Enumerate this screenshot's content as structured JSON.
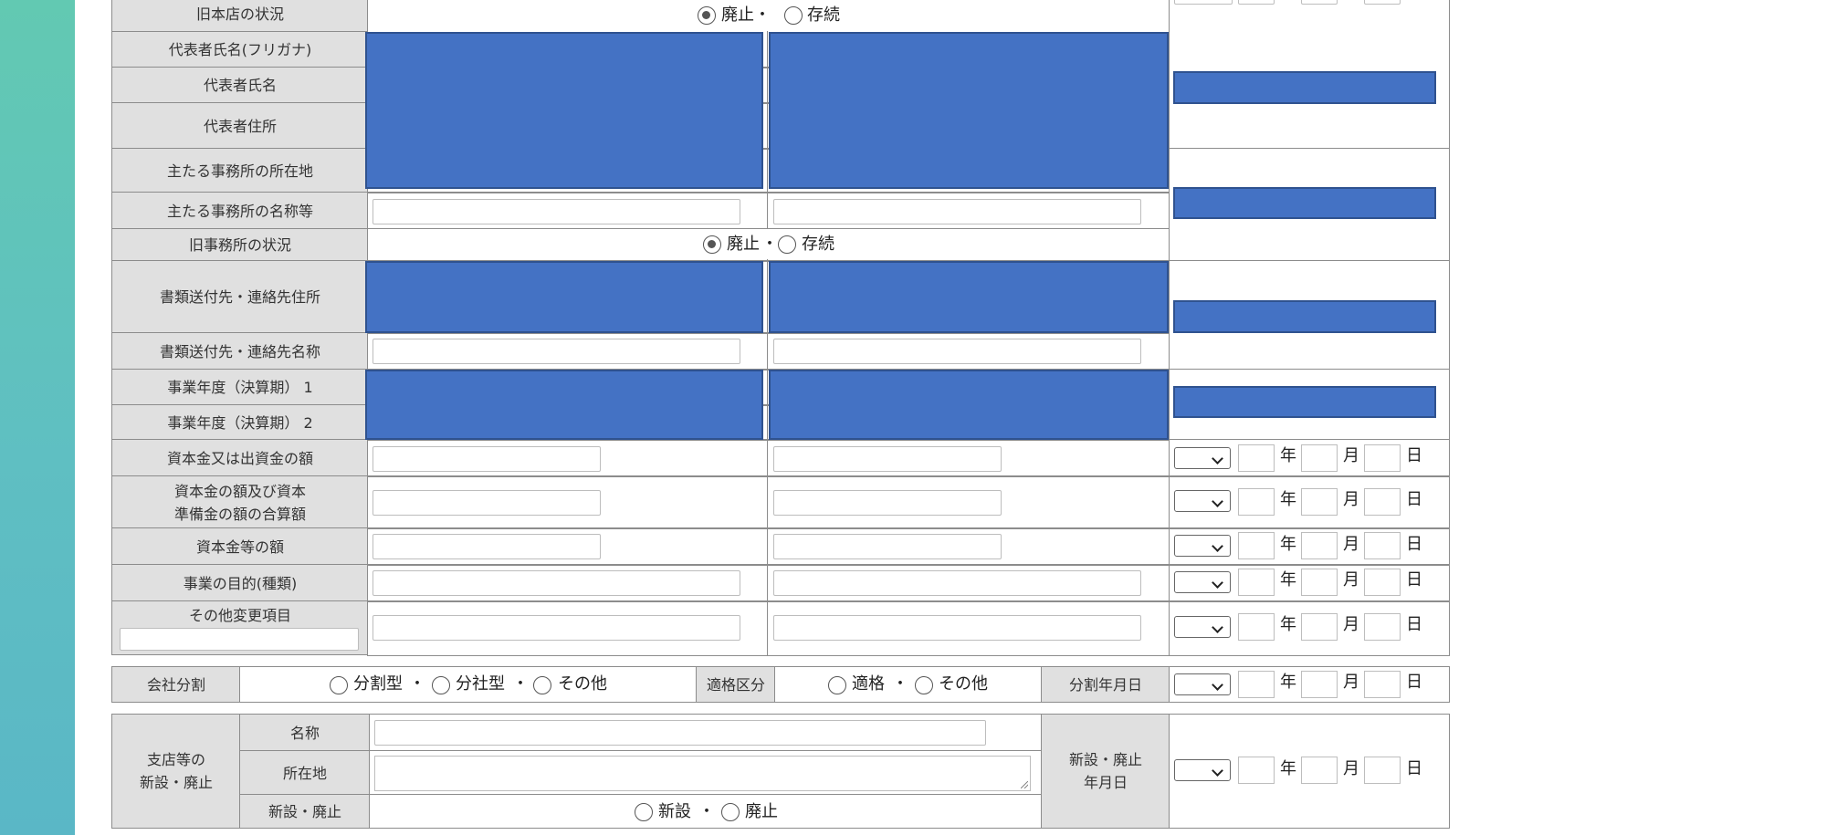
{
  "units": {
    "year": "年",
    "month": "月",
    "day": "日"
  },
  "labels": {
    "old_hq": "旧本店の状況",
    "rep_kana": "代表者氏名(フリガナ)",
    "rep_name": "代表者氏名",
    "rep_addr": "代表者住所",
    "office_loc": "主たる事務所の所在地",
    "office_name": "主たる事務所の名称等",
    "old_office": "旧事務所の状況",
    "doc_addr": "書類送付先・連絡先住所",
    "doc_name": "書類送付先・連絡先名称",
    "fy1": "事業年度（決算期） 1",
    "fy2": "事業年度（決算期） 2",
    "capital": "資本金又は出資金の額",
    "capital_sum_1": "資本金の額及び資本",
    "capital_sum_2": "準備金の額の合算額",
    "capital_etc": "資本金等の額",
    "purpose": "事業の目的(種類)",
    "other": "その他変更項目",
    "split": "会社分割",
    "qualify": "適格区分",
    "split_date": "分割年月日",
    "branch_1": "支店等の",
    "branch_2": "新設・廃止",
    "b_name": "名称",
    "b_loc": "所在地",
    "b_setup": "新設・廃止",
    "b_date_1": "新設・廃止",
    "b_date_2": "年月日"
  },
  "radios": {
    "abolish": "廃止",
    "exist": "存続",
    "split_type_a": "分割型",
    "split_type_b": "分社型",
    "other": "その他",
    "qualified": "適格",
    "new": "新設",
    "abolished": "廃止"
  },
  "sep": "・"
}
